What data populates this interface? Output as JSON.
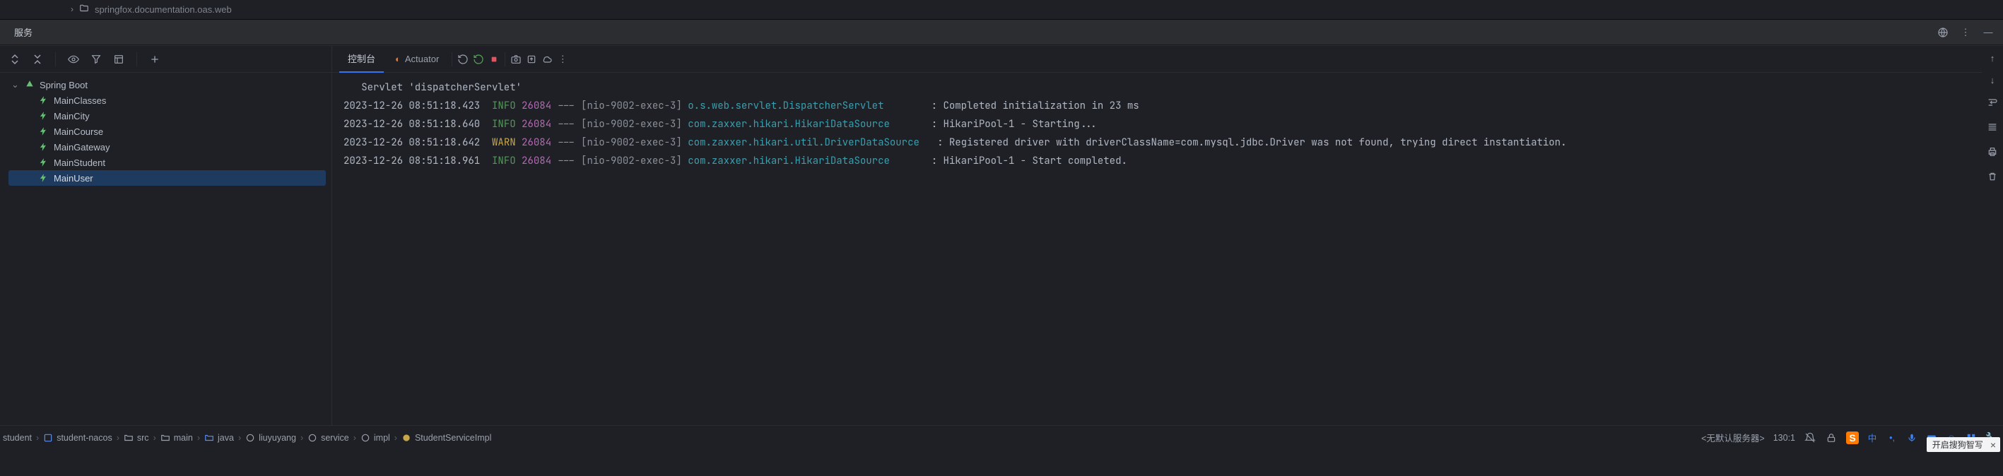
{
  "top": {
    "folder": "springfox.documentation.oas.web"
  },
  "panel": {
    "title": "服务"
  },
  "tree": {
    "root": "Spring Boot",
    "items": [
      {
        "label": "MainClasses"
      },
      {
        "label": "MainCity"
      },
      {
        "label": "MainCourse"
      },
      {
        "label": "MainGateway"
      },
      {
        "label": "MainStudent"
      },
      {
        "label": "MainUser"
      }
    ]
  },
  "tabs": {
    "console": "控制台",
    "actuator": "Actuator"
  },
  "log": {
    "pre": "Servlet 'dispatcherServlet'",
    "lines": [
      {
        "ts": "2023-12-26 08:51:18.423",
        "level": "INFO",
        "pid": "26084",
        "dash": "---",
        "thread": "[nio-9002-exec-3]",
        "logger": "o.s.web.servlet.DispatcherServlet",
        "pad": "       ",
        "msg": ": Completed initialization in 23 ms"
      },
      {
        "ts": "2023-12-26 08:51:18.640",
        "level": "INFO",
        "pid": "26084",
        "dash": "---",
        "thread": "[nio-9002-exec-3]",
        "logger": "com.zaxxer.hikari.HikariDataSource",
        "pad": "      ",
        "msg": ": HikariPool-1 - Starting..."
      },
      {
        "ts": "2023-12-26 08:51:18.642",
        "level": "WARN",
        "pid": "26084",
        "dash": "---",
        "thread": "[nio-9002-exec-3]",
        "logger": "com.zaxxer.hikari.util.DriverDataSource",
        "pad": "  ",
        "msg": ": Registered driver with driverClassName=com.mysql.jdbc.Driver was not found, trying direct instantiation."
      },
      {
        "ts": "2023-12-26 08:51:18.961",
        "level": "INFO",
        "pid": "26084",
        "dash": "---",
        "thread": "[nio-9002-exec-3]",
        "logger": "com.zaxxer.hikari.HikariDataSource",
        "pad": "      ",
        "msg": ": HikariPool-1 - Start completed."
      }
    ]
  },
  "breadcrumbs": {
    "items": [
      "student",
      "student-nacos",
      "src",
      "main",
      "java",
      "liuyuyang",
      "service",
      "impl",
      "StudentServiceImpl"
    ],
    "server": "<无默认服务器>",
    "position": "130:1"
  },
  "overlay": {
    "text": "开启搜狗智写"
  }
}
